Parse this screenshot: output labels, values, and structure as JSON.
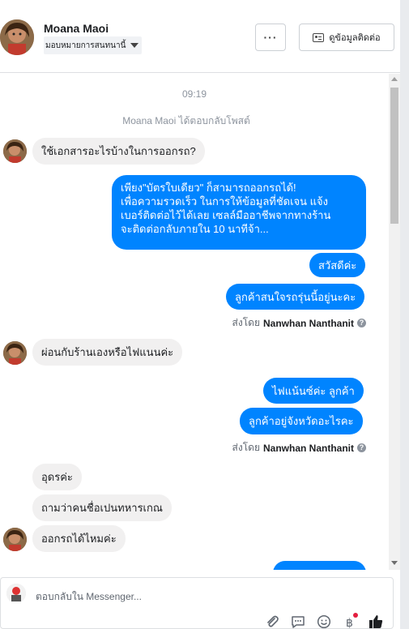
{
  "header": {
    "contact_name": "Moana Maoi",
    "assign_label": "มอบหมายการสนทนานี้",
    "more_label": "···",
    "contact_info_label": "ดูข้อมูลติดต่อ"
  },
  "chat": {
    "timestamp": "09:19",
    "event": "Moana Maoi ได้ตอบกลับโพสต์",
    "messages": {
      "m1": "ใช้เอกสารอะไรบ้างในการออกรถ?",
      "m2_line1": "เพียง\"บัตรใบเดียว\" ก็สามารถออกรถได้!",
      "m2_line2": "เพื่อความรวดเร็ว ในการให้ข้อมูลที่ชัดเจน แจ้ง",
      "m2_line3": "เบอร์ติดต่อไว้ได้เลย เซลล์มืออาชีพจากทางร้าน",
      "m2_line4": "จะติดต่อกลับภายใน 10 นาทีจ้า...",
      "m3": "สวัสดีค่ะ",
      "m4": "ลูกค้าสนใจรถรุ่นนี้อยู่นะคะ",
      "m5": "ผ่อนกับร้านเองหรือไฟแนนค่ะ",
      "m6": "ไฟแน้นซ์ค่ะ ลูกค้า",
      "m7": "ลูกค้าอยู่จังหวัดอะไรคะ",
      "m8": "อุดรค่ะ",
      "m9": "ถามว่าคนชื่อเปนทหารเกณ",
      "m10": "ออกรถได้ไหมค่ะ"
    },
    "sent_by_prefix": "ส่งโดย",
    "sent_by_name": "Nanwhan Nanthanit",
    "info_glyph": "?"
  },
  "composer": {
    "placeholder": "ตอบกลับใน Messenger..."
  },
  "colors": {
    "outgoing": "#0084ff",
    "incoming": "#f1f0f0",
    "muted": "#8d949e"
  },
  "icons": [
    "paperclip-icon",
    "saved-reply-icon",
    "emoji-icon",
    "payment-icon",
    "thumbs-up-icon"
  ]
}
